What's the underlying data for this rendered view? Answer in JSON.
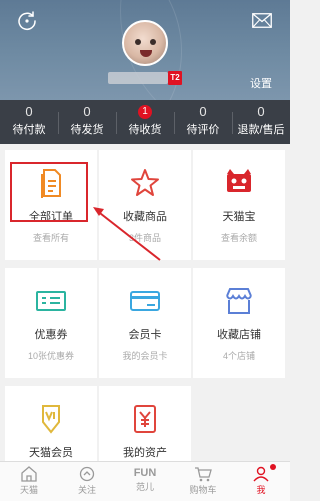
{
  "header": {
    "level_badge": "T2",
    "settings_label": "设置"
  },
  "order_status": [
    {
      "count": "0",
      "label": "待付款"
    },
    {
      "count": "0",
      "label": "待发货"
    },
    {
      "count": "1",
      "label": "待收货",
      "highlight": true
    },
    {
      "count": "0",
      "label": "待评价"
    },
    {
      "count": "0",
      "label": "退款/售后"
    }
  ],
  "grid": [
    {
      "title": "全部订单",
      "sub": "查看所有",
      "icon": "order-doc-icon",
      "color": "#f08a24"
    },
    {
      "title": "收藏商品",
      "sub": "3件商品",
      "icon": "star-icon",
      "color": "#e0453c"
    },
    {
      "title": "天猫宝",
      "sub": "查看余额",
      "icon": "tmall-treasure-icon",
      "color": "#d9262c"
    },
    {
      "title": "优惠券",
      "sub": "10张优惠券",
      "icon": "coupon-icon",
      "color": "#2bb4a0"
    },
    {
      "title": "会员卡",
      "sub": "我的会员卡",
      "icon": "vip-card-icon",
      "color": "#3aa7e0"
    },
    {
      "title": "收藏店铺",
      "sub": "4个店铺",
      "icon": "shop-icon",
      "color": "#5b7fd6"
    },
    {
      "title": "天猫会员",
      "sub": "",
      "icon": "vip-member-icon",
      "color": "#e0b83c"
    },
    {
      "title": "我的资产",
      "sub": "",
      "icon": "assets-icon",
      "color": "#e0453c"
    }
  ],
  "tabs": [
    {
      "label": "天猫",
      "icon": "home-icon"
    },
    {
      "label": "关注",
      "icon": "follow-icon"
    },
    {
      "label": "范儿",
      "icon": "fun-icon",
      "text": "FUN"
    },
    {
      "label": "购物车",
      "icon": "cart-icon"
    },
    {
      "label": "我",
      "icon": "me-icon",
      "active": true
    }
  ]
}
